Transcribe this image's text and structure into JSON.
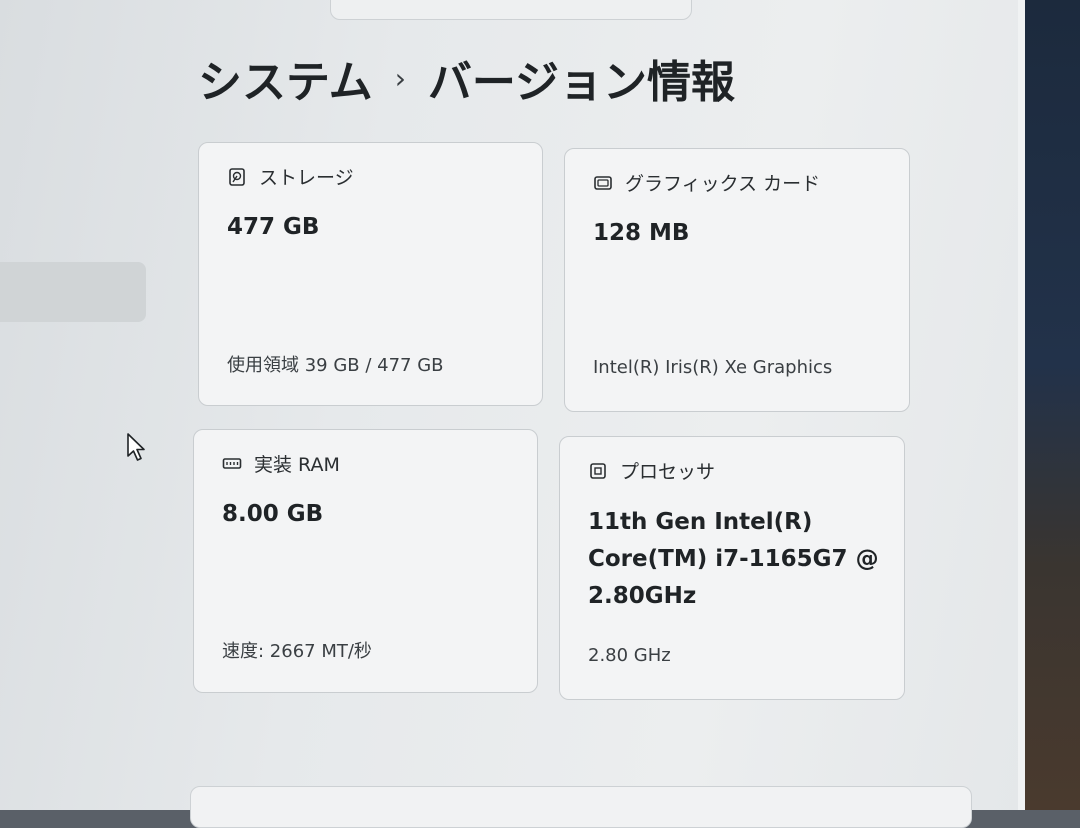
{
  "breadcrumb": {
    "parent": "システム",
    "separator": "›",
    "current": "バージョン情報"
  },
  "cards": {
    "storage": {
      "icon": "hard-drive-icon",
      "title": "ストレージ",
      "value": "477 GB",
      "detail": "使用領域 39 GB / 477 GB"
    },
    "graphics": {
      "icon": "graphics-card-icon",
      "title": "グラフィックス カード",
      "value": "128 MB",
      "detail": "Intel(R) Iris(R) Xe Graphics"
    },
    "ram": {
      "icon": "memory-icon",
      "title": "実装 RAM",
      "value": "8.00 GB",
      "detail": "速度: 2667 MT/秒"
    },
    "processor": {
      "icon": "processor-icon",
      "title": "プロセッサ",
      "value_lines": [
        "11th Gen Intel(R)",
        "Core(TM) i7-1165G7 @",
        "2.80GHz"
      ],
      "detail": "2.80 GHz"
    }
  }
}
